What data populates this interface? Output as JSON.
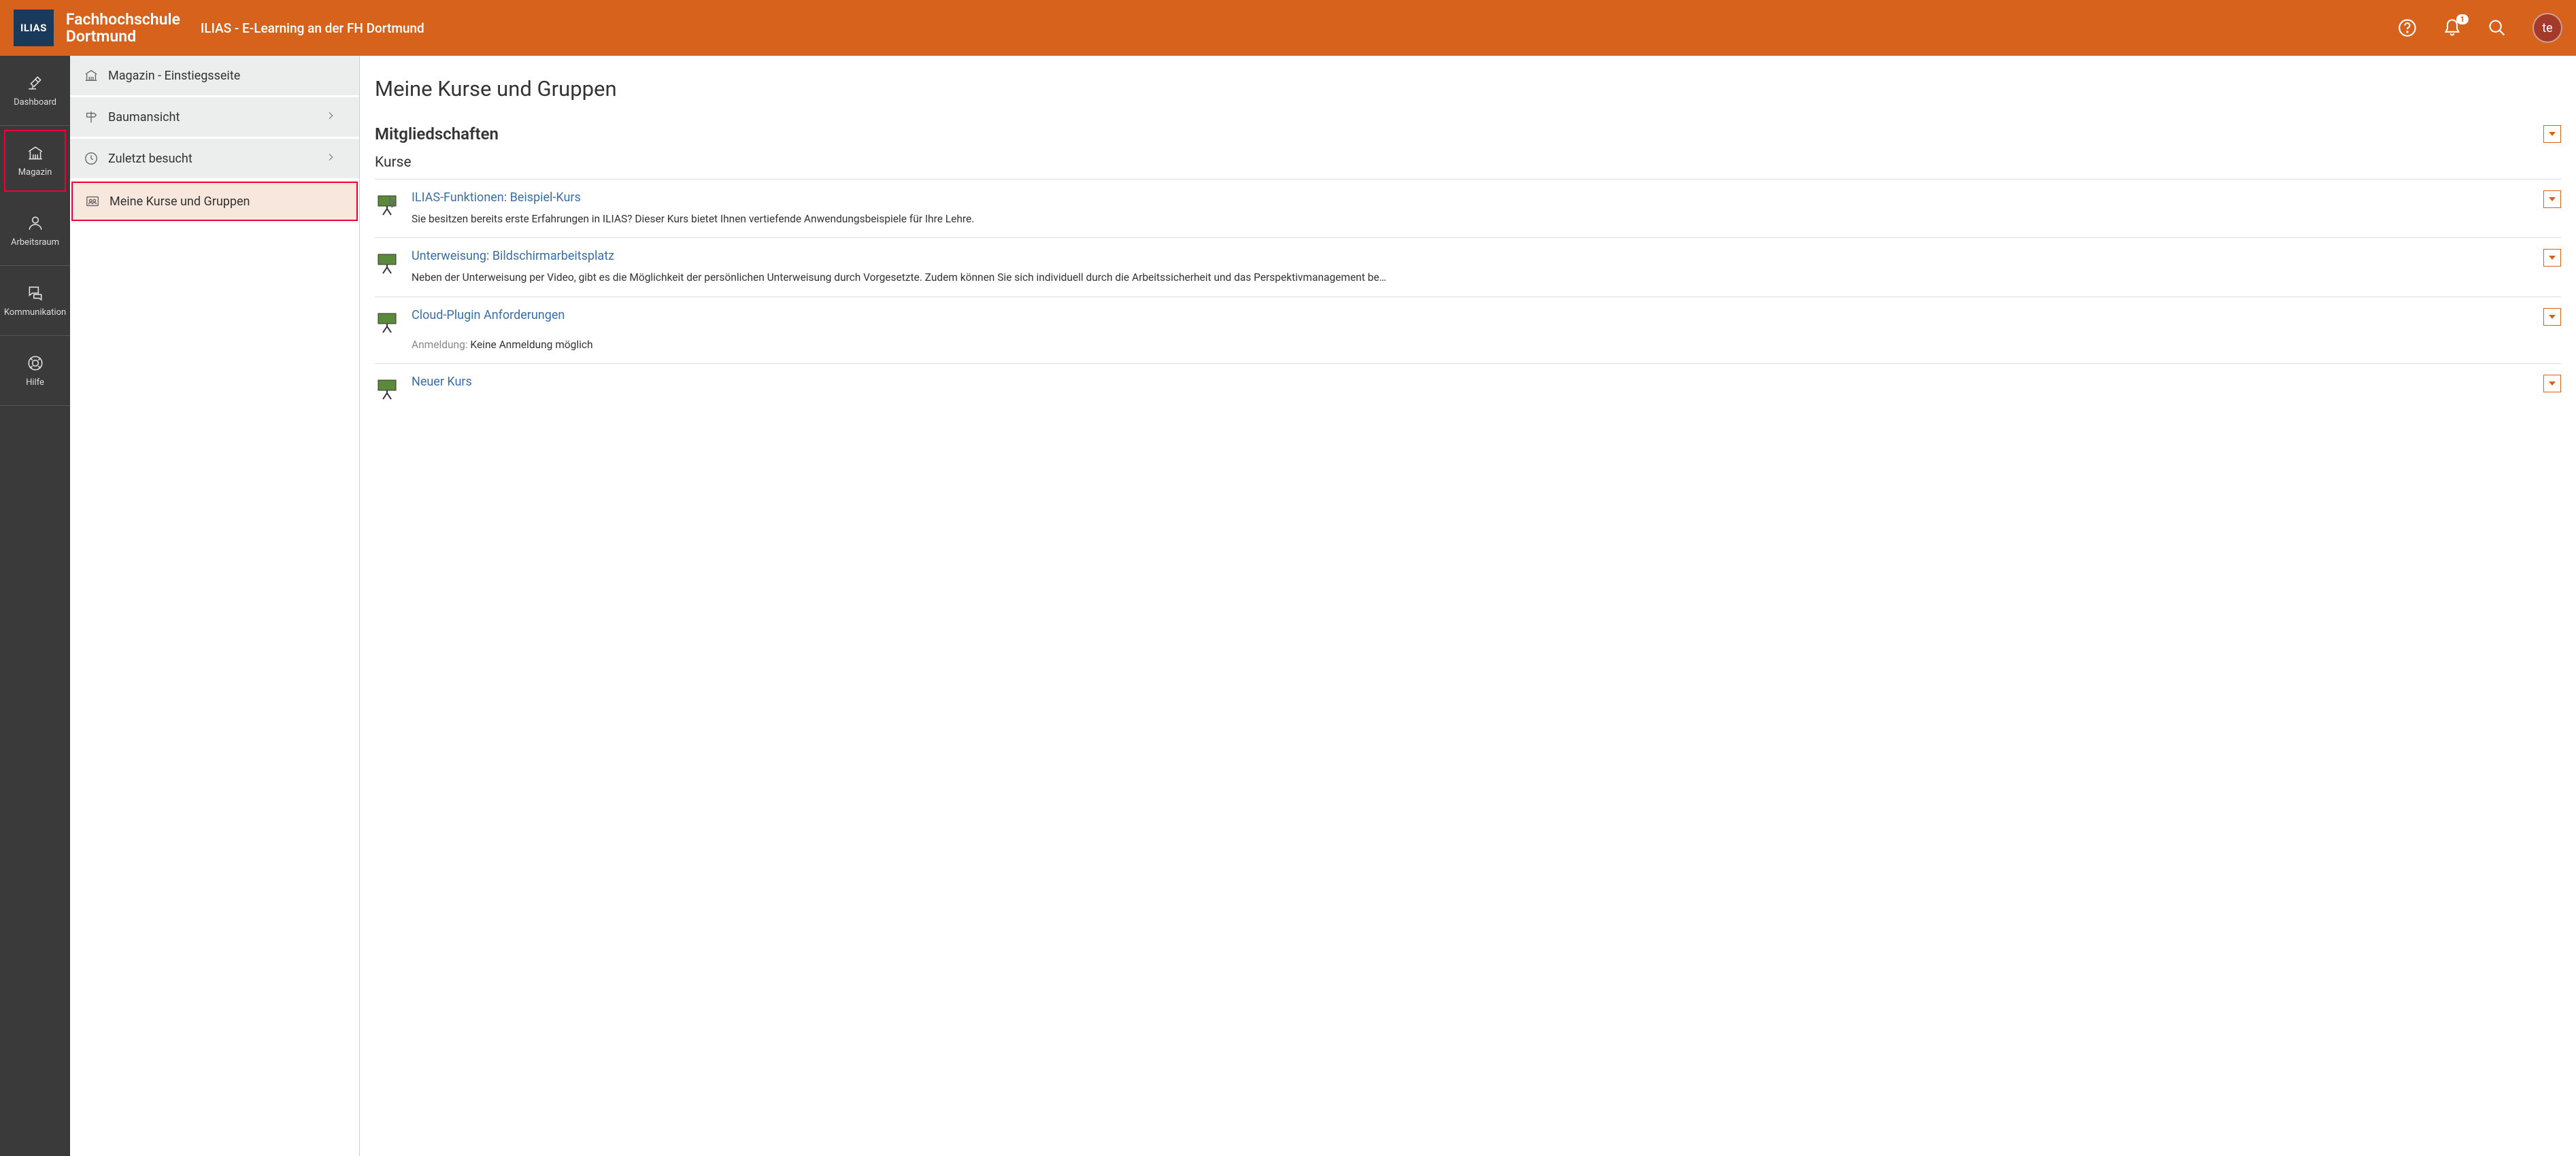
{
  "header": {
    "logo_text": "ILIAS",
    "org_line1": "Fachhochschule",
    "org_line2": "Dortmund",
    "app_title": "ILIAS - E-Learning an der FH Dortmund",
    "notification_count": "1",
    "avatar_initials": "te"
  },
  "sidebar": {
    "items": [
      {
        "label": "Dashboard"
      },
      {
        "label": "Magazin"
      },
      {
        "label": "Arbeitsraum"
      },
      {
        "label": "Kommunikation"
      },
      {
        "label": "Hilfe"
      }
    ]
  },
  "submenu": {
    "items": [
      {
        "label": "Magazin - Einstiegsseite"
      },
      {
        "label": "Baumansicht"
      },
      {
        "label": "Zuletzt besucht"
      },
      {
        "label": "Meine Kurse und Gruppen"
      }
    ]
  },
  "content": {
    "page_title": "Meine Kurse und Gruppen",
    "section_title": "Mitgliedschaften",
    "subsection_title": "Kurse",
    "courses": [
      {
        "title": "ILIAS-Funktionen: Beispiel-Kurs",
        "desc": "Sie besitzen bereits erste Erfahrungen in ILIAS? Dieser Kurs bietet Ihnen vertiefende Anwendungsbeispiele für Ihre Lehre."
      },
      {
        "title": "Unterweisung: Bildschirmarbeitsplatz",
        "desc": "Neben der Unterweisung per Video, gibt es die Möglichkeit der persönlichen Unterweisung durch Vorgesetzte. Zudem können Sie sich individuell durch die Arbeitssicherheit und das Perspektivmanagement be…"
      },
      {
        "title": "Cloud-Plugin Anforderungen",
        "meta_label": "Anmeldung:",
        "meta_value": "Keine Anmeldung möglich"
      },
      {
        "title": "Neuer Kurs"
      }
    ]
  }
}
